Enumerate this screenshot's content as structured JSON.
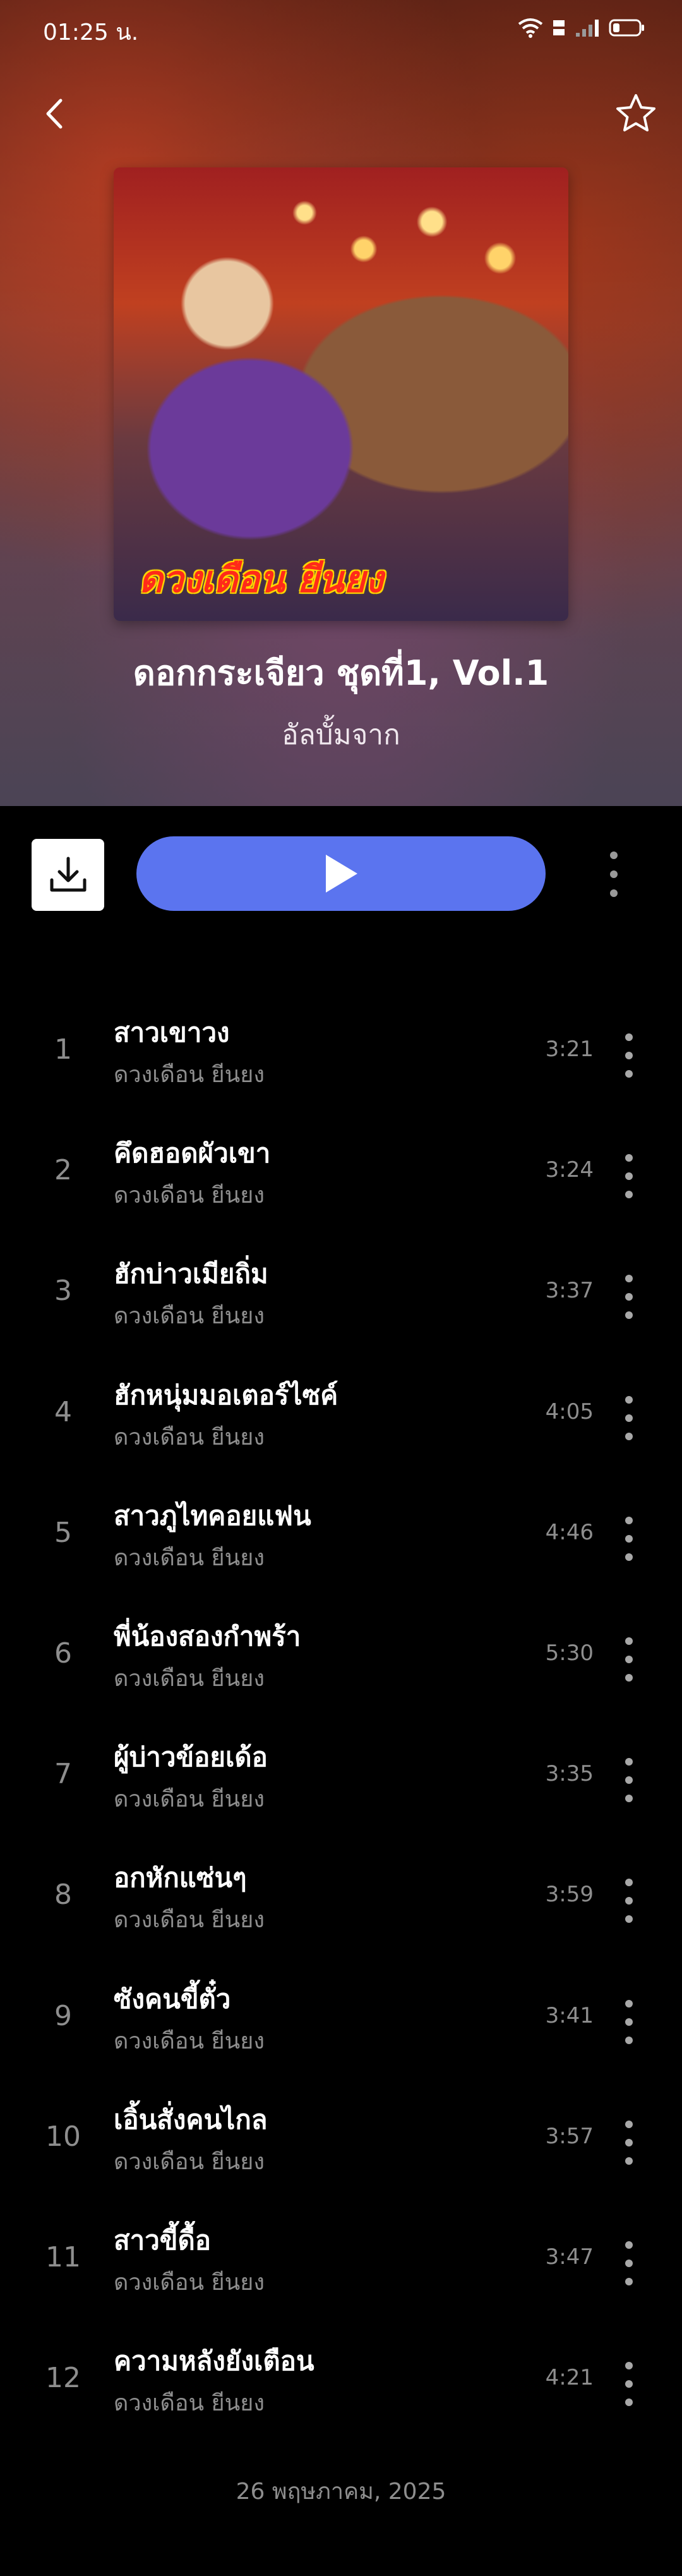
{
  "status_bar": {
    "time": "01:25 น.",
    "icons": [
      "wifi-icon",
      "volte-icon",
      "signal-icon",
      "battery-icon"
    ]
  },
  "header": {
    "back_icon": "chevron-left-icon",
    "favorite_icon": "star-outline-icon"
  },
  "album": {
    "cover_text": "ดวงเดือน ยีนยง",
    "title": "ดอกกระเจียว ชุดที่1, Vol.1",
    "subtitle": "อัลบั้มจาก"
  },
  "actions": {
    "download_icon": "download-icon",
    "play_icon": "play-icon",
    "more_icon": "more-vertical-icon"
  },
  "tracks": [
    {
      "number": "1",
      "title": "สาวเขาวง",
      "artist": "ดวงเดือน ยีนยง",
      "duration": "3:21"
    },
    {
      "number": "2",
      "title": "คึดฮอดผัวเขา",
      "artist": "ดวงเดือน ยีนยง",
      "duration": "3:24"
    },
    {
      "number": "3",
      "title": "ฮักบ่าวเมียถิ่ม",
      "artist": "ดวงเดือน ยีนยง",
      "duration": "3:37"
    },
    {
      "number": "4",
      "title": "ฮักหนุ่มมอเตอร์ไซค์",
      "artist": "ดวงเดือน ยีนยง",
      "duration": "4:05"
    },
    {
      "number": "5",
      "title": "สาวภูไทคอยแฟน",
      "artist": "ดวงเดือน ยีนยง",
      "duration": "4:46"
    },
    {
      "number": "6",
      "title": "พี่น้องสองกำพร้า",
      "artist": "ดวงเดือน ยีนยง",
      "duration": "5:30"
    },
    {
      "number": "7",
      "title": "ผู้บ่าวข้อยเด้อ",
      "artist": "ดวงเดือน ยีนยง",
      "duration": "3:35"
    },
    {
      "number": "8",
      "title": "อกหักแซ่นๆ",
      "artist": "ดวงเดือน ยีนยง",
      "duration": "3:59"
    },
    {
      "number": "9",
      "title": "ซังคนขี้ตั๋ว",
      "artist": "ดวงเดือน ยีนยง",
      "duration": "3:41"
    },
    {
      "number": "10",
      "title": "เอิ้นสั่งคนไกล",
      "artist": "ดวงเดือน ยีนยง",
      "duration": "3:57"
    },
    {
      "number": "11",
      "title": "สาวขี้ดื้อ",
      "artist": "ดวงเดือน ยีนยง",
      "duration": "3:47"
    },
    {
      "number": "12",
      "title": "ความหลังยังเตือน",
      "artist": "ดวงเดือน ยีนยง",
      "duration": "4:21"
    }
  ],
  "footer": {
    "release_date": "26 พฤษภาคม, 2025"
  },
  "colors": {
    "play_button": "#5b74ef",
    "background": "#000000",
    "secondary_text": "#8e8e8e"
  }
}
